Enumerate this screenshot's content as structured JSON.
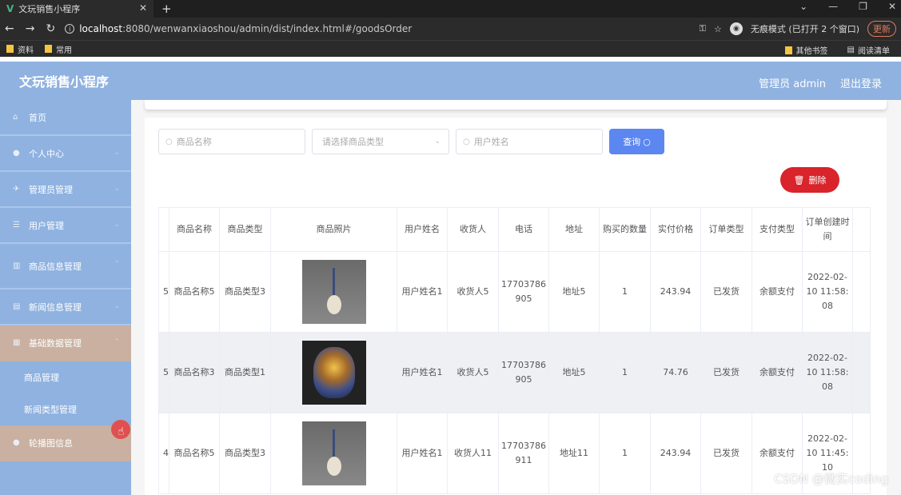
{
  "browser": {
    "tab_title": "文玩销售小程序",
    "url_host": "localhost",
    "url_rest": ":8080/wenwanxiaoshou/admin/dist/index.html#/goodsOrder",
    "incognito_label": "无痕模式 (已打开 2 个窗口)",
    "update_label": "更新",
    "bookmarks": [
      "资料",
      "常用"
    ],
    "bookmarks_right": [
      "其他书签",
      "阅读清单"
    ]
  },
  "header": {
    "title": "文玩销售小程序",
    "admin_label": "管理员 admin",
    "logout_label": "退出登录"
  },
  "sidebar": {
    "items": [
      {
        "label": "首页"
      },
      {
        "label": "个人中心"
      },
      {
        "label": "管理员管理"
      },
      {
        "label": "用户管理"
      },
      {
        "label": "商品信息管理"
      },
      {
        "label": "新闻信息管理"
      },
      {
        "label": "基础数据管理"
      },
      {
        "label": "商品管理"
      },
      {
        "label": "新闻类型管理"
      },
      {
        "label": "轮播图信息"
      }
    ]
  },
  "search": {
    "goods_name_placeholder": "商品名称",
    "goods_type_placeholder": "请选择商品类型",
    "user_name_placeholder": "用户姓名",
    "query_label": "查询",
    "delete_label": "删除"
  },
  "table": {
    "headers": [
      "商品名称",
      "商品类型",
      "商品照片",
      "用户姓名",
      "收货人",
      "电话",
      "地址",
      "购买的数量",
      "实付价格",
      "订单类型",
      "支付类型",
      "订单创建时间"
    ],
    "rows": [
      {
        "index": "5",
        "goods_name": "商品名称5",
        "goods_type": "商品类型3",
        "photo": "pendant",
        "user_name": "用户姓名1",
        "receiver": "收货人5",
        "phone": "17703786905",
        "address": "地址5",
        "quantity": "1",
        "price": "243.94",
        "order_type": "已发货",
        "pay_type": "余额支付",
        "created": "2022-02-10 11:58:08"
      },
      {
        "index": "5",
        "goods_name": "商品名称3",
        "goods_type": "商品类型1",
        "photo": "vase",
        "user_name": "用户姓名1",
        "receiver": "收货人5",
        "phone": "17703786905",
        "address": "地址5",
        "quantity": "1",
        "price": "74.76",
        "order_type": "已发货",
        "pay_type": "余额支付",
        "created": "2022-02-10 11:58:08"
      },
      {
        "index": "4",
        "goods_name": "商品名称5",
        "goods_type": "商品类型3",
        "photo": "pendant",
        "user_name": "用户姓名1",
        "receiver": "收货人11",
        "phone": "17703786911",
        "address": "地址11",
        "quantity": "1",
        "price": "243.94",
        "order_type": "已发货",
        "pay_type": "余额支付",
        "created": "2022-02-10 11:45:10"
      }
    ]
  },
  "watermark": "CSDN @微实coding"
}
